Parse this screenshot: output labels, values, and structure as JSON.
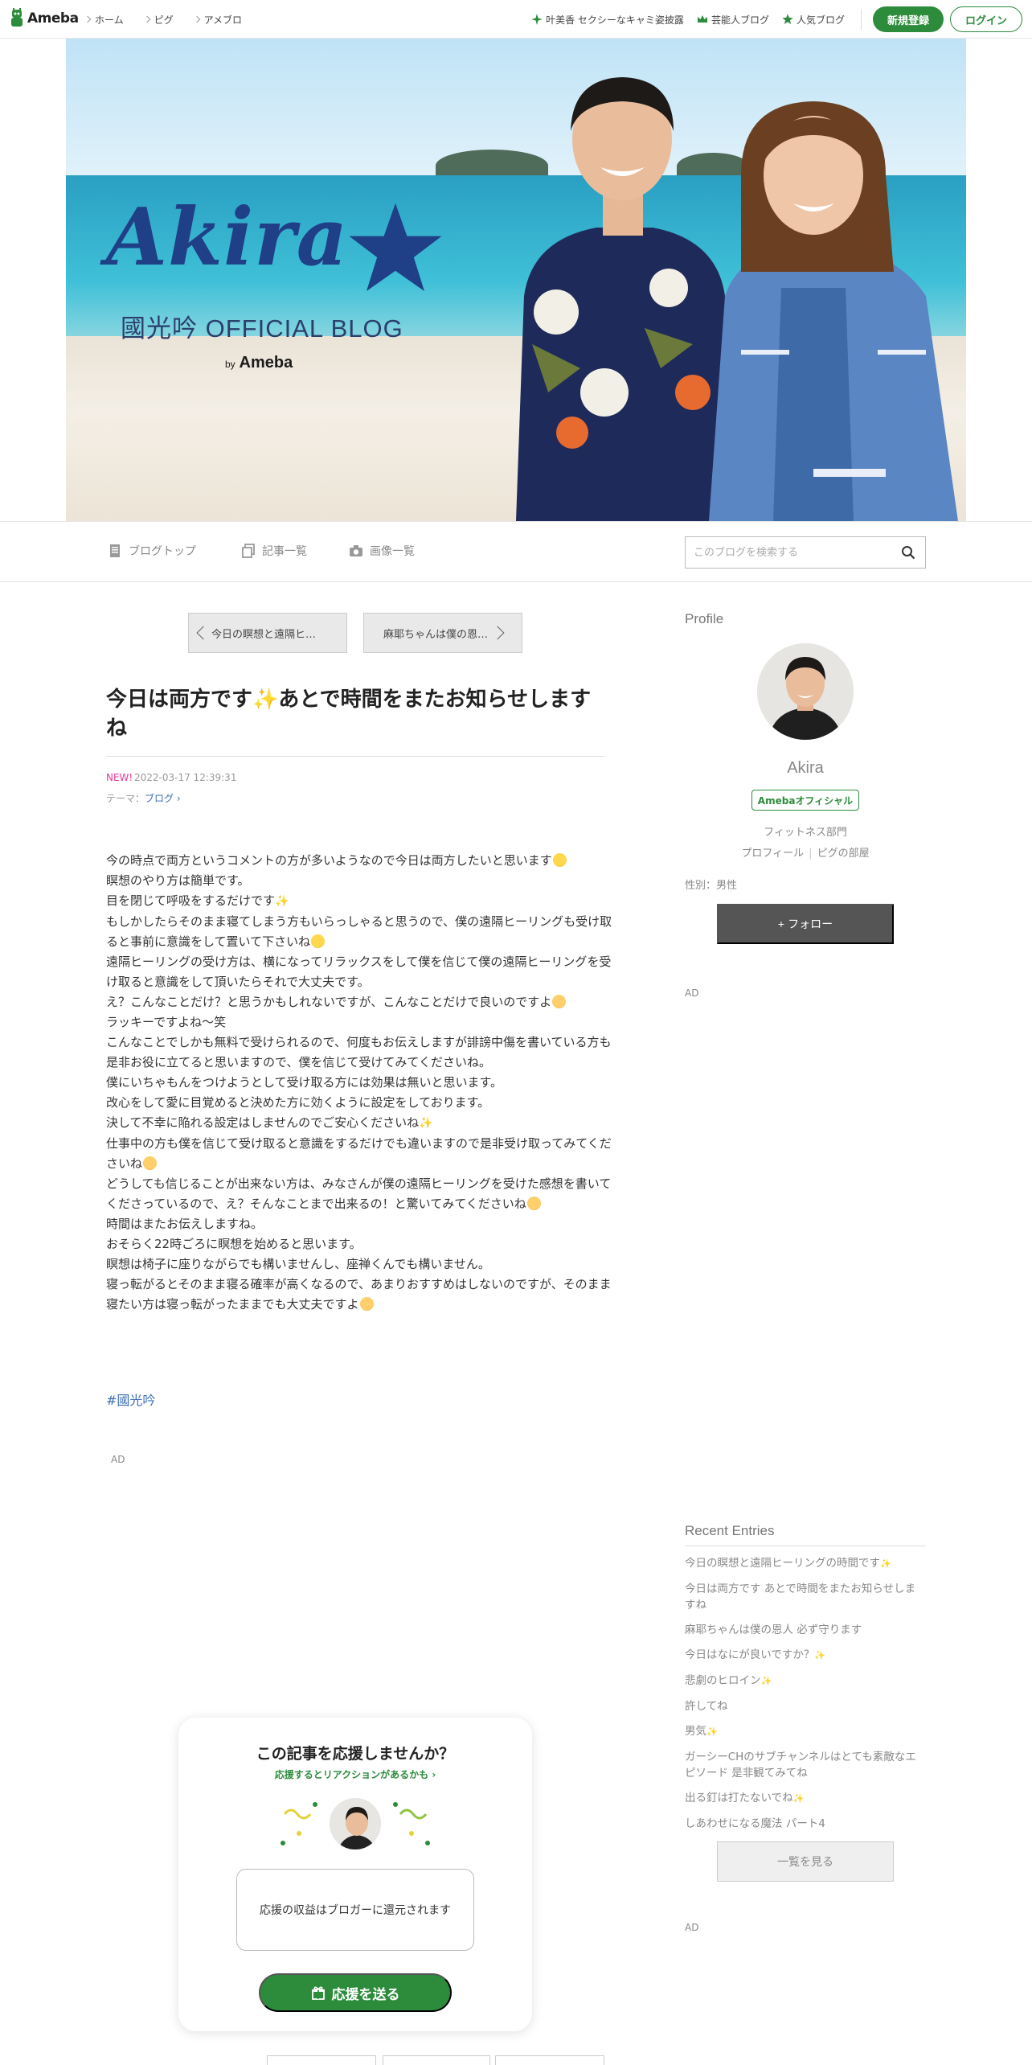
{
  "topbar": {
    "logo_text": "Ameba",
    "nav": [
      "ホーム",
      "ピグ",
      "アメブロ"
    ],
    "right_links": [
      "叶美香 セクシーなキャミ姿披露",
      "芸能人ブログ",
      "人気ブログ"
    ],
    "signup_label": "新規登録",
    "login_label": "ログイン",
    "accent": "#2d8c3c"
  },
  "hero": {
    "title": "Akira",
    "subtitle": "國光吟 OFFICIAL BLOG",
    "by": "by",
    "brand": "Ameba"
  },
  "subnav": {
    "items": [
      "ブログトップ",
      "記事一覧",
      "画像一覧"
    ],
    "search_placeholder": "このブログを検索する"
  },
  "pager": {
    "prev": "今日の瞑想と遠隔ヒ…",
    "next": "麻耶ちゃんは僕の恩…"
  },
  "article": {
    "title": "今日は両方です✨あとで時間をまたお知らせしますね",
    "new_label": "NEW!",
    "date": "2022-03-17 12:39:31",
    "theme_label": "テーマ：",
    "theme_value": "ブログ",
    "paragraphs": [
      "今の時点で両方というコメントの方が多いようなので今日は両方したいと思います",
      "瞑想のやり方は簡単です。",
      "目を閉じて呼吸をするだけです",
      "もしかしたらそのまま寝てしまう方もいらっしゃると思うので、僕の遠隔ヒーリングも受け取ると事前に意識をして置いて下さいね",
      "遠隔ヒーリングの受け方は、横になってリラックスをして僕を信じて僕の遠隔ヒーリングを受け取ると意識をして頂いたらそれで大丈夫です。",
      "え？こんなことだけ？と思うかもしれないですが、こんなことだけで良いのですよ",
      "ラッキーですよね〜笑",
      "こんなことでしかも無料で受けられるので、何度もお伝えしますが誹謗中傷を書いている方も是非お役に立てると思いますので、僕を信じて受けてみてくださいね。",
      "僕にいちゃもんをつけようとして受け取る方には効果は無いと思います。",
      "改心をして愛に目覚めると決めた方に効くように設定をしております。",
      "決して不幸に陥れる設定はしませんのでご安心くださいね",
      "仕事中の方も僕を信じて受け取ると意識をするだけでも違いますので是非受け取ってみてくださいね",
      "どうしても信じることが出来ない方は、みなさんが僕の遠隔ヒーリングを受けた感想を書いてくださっているので、え？そんなことまで出来るの！と驚いてみてくださいね",
      "時間はまたお伝えしますね。",
      "おそらく22時ごろに瞑想を始めると思います。",
      "瞑想は椅子に座りながらでも構いませんし、座禅くんでも構いません。",
      "寝っ転がるとそのまま寝る確率が高くなるので、あまりおすすめはしないのですが、そのまま寝たい方は寝っ転がったままでも大丈夫ですよ"
    ],
    "hashtag": "#國光吟",
    "ad": "AD"
  },
  "support": {
    "title": "この記事を応援しませんか？",
    "link": "応援するとリアクションがあるかも",
    "box_text": "応援の収益はブロガーに還元されます",
    "button": "応援を送る"
  },
  "sidebar": {
    "profile_heading": "Profile",
    "name": "Akira",
    "badge": "Amebaオフィシャル",
    "category": "フィットネス部門",
    "link_profile": "プロフィール",
    "link_room": "ピグの部屋",
    "gender": "性別：男性",
    "follow": "フォロー",
    "ad": "AD",
    "recent_heading": "Recent Entries",
    "recent": [
      "今日の瞑想と遠隔ヒーリングの時間です",
      "今日は両方です あとで時間をまたお知らせしますね",
      "麻耶ちゃんは僕の恩人 必ず守ります",
      "今日はなにが良いですか？",
      "悲劇のヒロイン",
      "許してね",
      "男気",
      "ガーシーCHのサブチャンネルはとても素敵なエピソード 是非観てみてね",
      "出る釘は打たないでね",
      "しあわせになる魔法 パート4"
    ],
    "more": "一覧を見る",
    "ad2": "AD"
  }
}
